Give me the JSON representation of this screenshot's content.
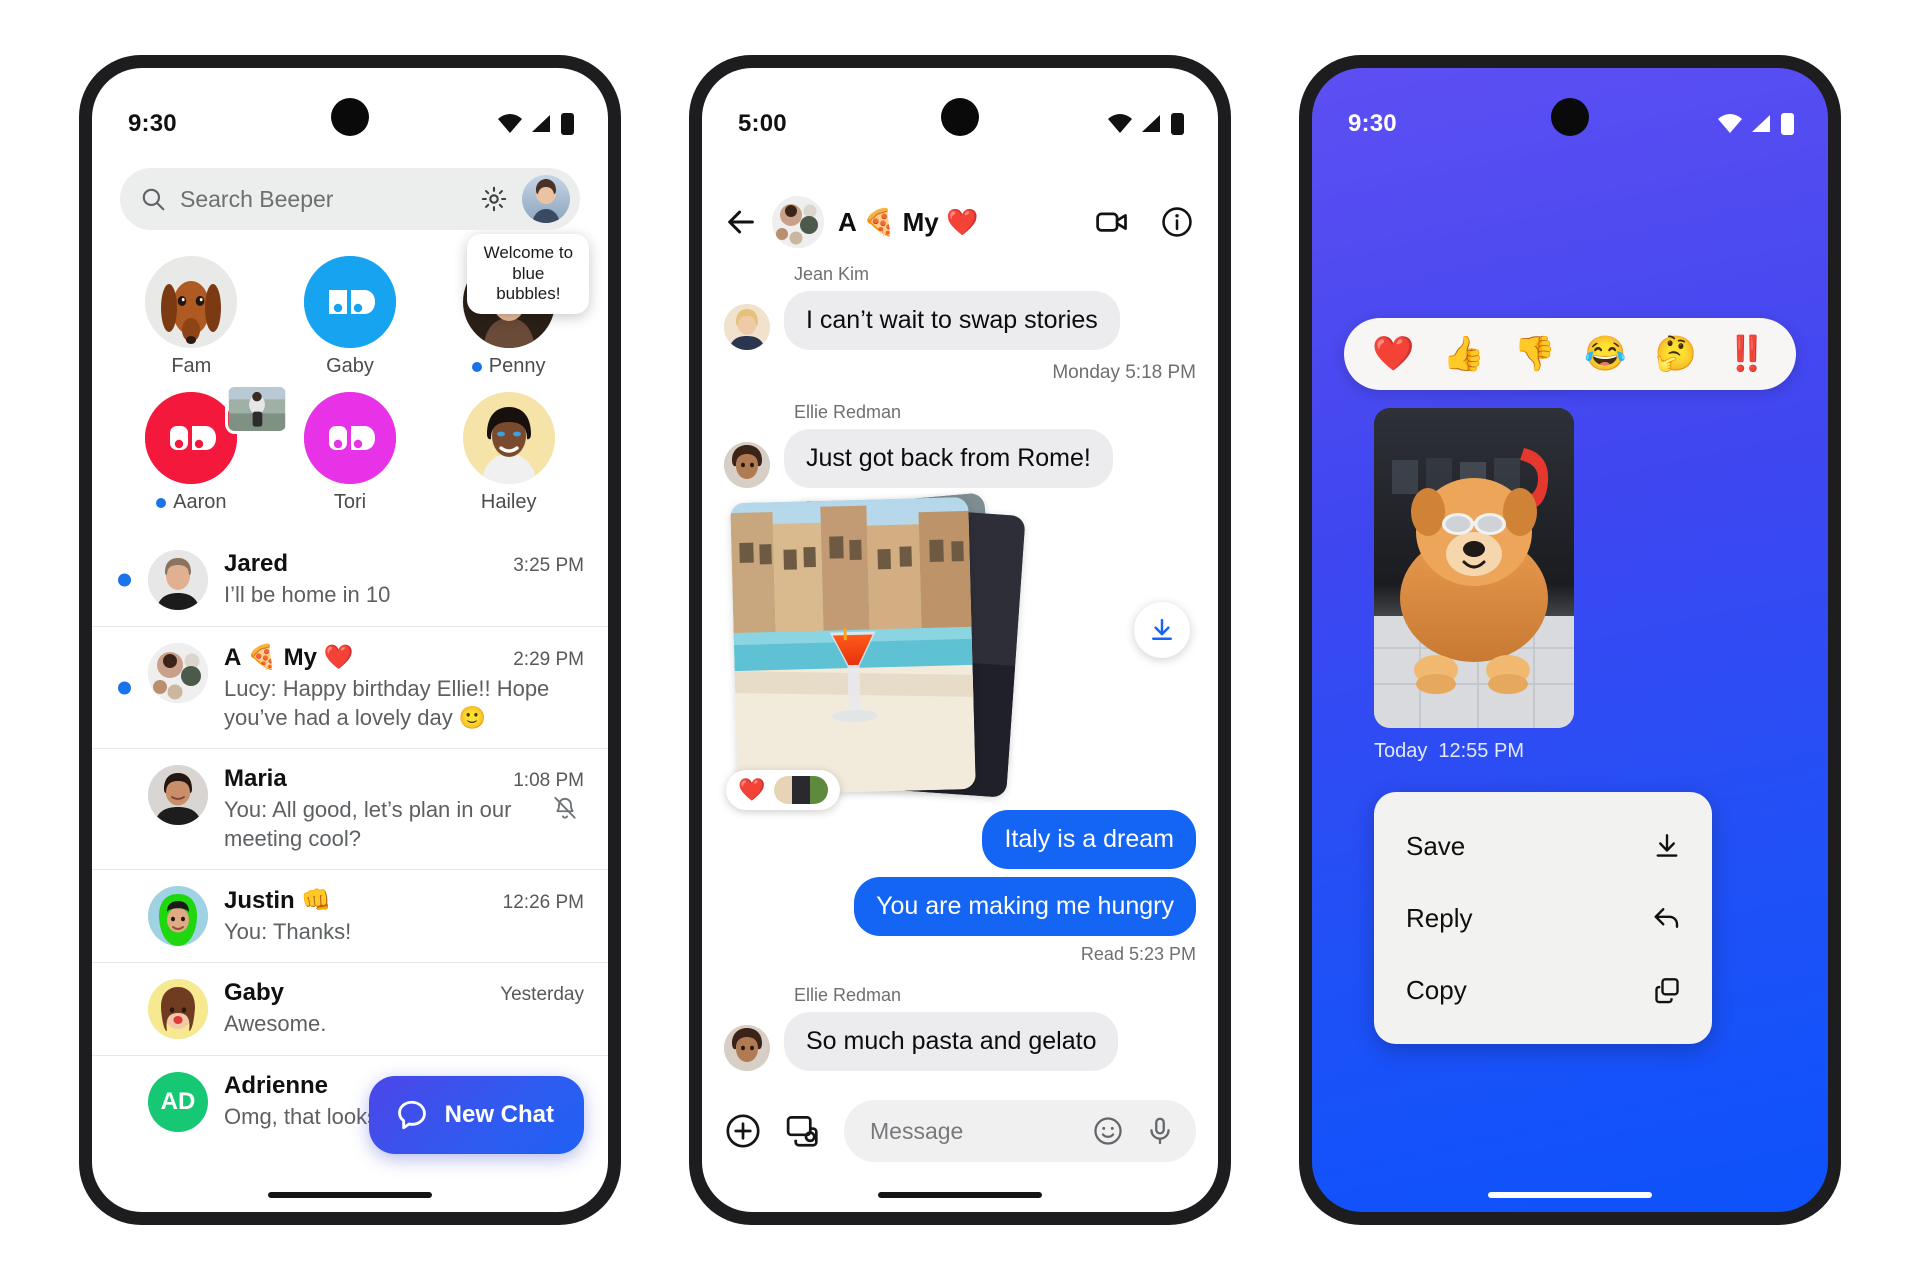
{
  "phone1": {
    "status": {
      "time": "9:30"
    },
    "search": {
      "placeholder": "Search Beeper",
      "icon": "search-icon",
      "settings_icon": "gear-icon"
    },
    "pinned": [
      {
        "name": "Fam",
        "unread": false,
        "avatar": "dog-photo"
      },
      {
        "name": "Gaby",
        "unread": false,
        "avatar": "beeper-logo-blue"
      },
      {
        "name": "Penny",
        "unread": true,
        "avatar": "woman-photo",
        "tooltip": "Welcome to blue bubbles!"
      },
      {
        "name": "Aaron",
        "unread": true,
        "avatar": "beeper-logo-red",
        "mini_thumb": true
      },
      {
        "name": "Tori",
        "unread": false,
        "avatar": "beeper-logo-magenta"
      },
      {
        "name": "Hailey",
        "unread": false,
        "avatar": "woman-photo-2"
      }
    ],
    "chats": [
      {
        "name": "Jared",
        "time": "3:25 PM",
        "preview": "I’ll be home in 10",
        "unread": true,
        "muted": false,
        "avatar": "man-black-shirt"
      },
      {
        "name": "A 🍕 My ❤️",
        "time": "2:29 PM",
        "preview": "Lucy: Happy birthday Ellie!! Hope you’ve had a lovely day  🙂",
        "unread": true,
        "muted": false,
        "avatar": "group-cluster"
      },
      {
        "name": "Maria",
        "time": "1:08 PM",
        "preview": "You: All good, let’s plan in our meeting cool?",
        "unread": false,
        "muted": true,
        "avatar": "woman-smiling"
      },
      {
        "name": "Justin 👊",
        "time": "12:26 PM",
        "preview": "You: Thanks!",
        "unread": false,
        "muted": false,
        "avatar": "man-green-hood"
      },
      {
        "name": "Gaby",
        "time": "Yesterday",
        "preview": "Awesome.",
        "unread": false,
        "muted": false,
        "avatar": "memoji-yellow"
      },
      {
        "name": "Adrienne",
        "time": "",
        "preview": "Omg, that looks so nice!",
        "unread": false,
        "muted": false,
        "avatar": "initials-green",
        "initials": "AD"
      }
    ],
    "fab": {
      "label": "New Chat",
      "icon": "chat-bubble-icon"
    }
  },
  "phone2": {
    "status": {
      "time": "5:00"
    },
    "header": {
      "back_icon": "back-arrow-icon",
      "title": "A 🍕 My ❤️",
      "video_icon": "video-camera-icon",
      "info_icon": "info-circle-icon"
    },
    "messages": [
      {
        "type": "incoming",
        "sender": "Jean Kim",
        "text": "I can’t wait to swap stories",
        "avatar": "woman-blonde"
      },
      {
        "type": "timestamp",
        "text": "Monday 5:18 PM"
      },
      {
        "type": "incoming",
        "sender": "Ellie Redman",
        "text": "Just got back from Rome!",
        "avatar": "woman-curly"
      },
      {
        "type": "photo_stack",
        "reaction": "❤️",
        "download_icon": "download-icon"
      },
      {
        "type": "outgoing",
        "text": "Italy is a dream"
      },
      {
        "type": "outgoing",
        "text": "You are making me hungry"
      },
      {
        "type": "read_receipt",
        "text": "Read  5:23 PM"
      },
      {
        "type": "incoming",
        "sender": "Ellie Redman",
        "text": "So much pasta and gelato",
        "avatar": "woman-curly"
      }
    ],
    "composer": {
      "plus_icon": "plus-circle-icon",
      "gallery_icon": "photo-camera-icon",
      "placeholder": "Message",
      "emoji_icon": "emoji-smiley-icon",
      "mic_icon": "microphone-icon"
    }
  },
  "phone3": {
    "status": {
      "time": "9:30"
    },
    "reactions": [
      "❤️",
      "👍",
      "👎",
      "😂",
      "🤔",
      "‼️"
    ],
    "media": {
      "caption_day": "Today",
      "caption_time": "12:55 PM",
      "alt": "dog-with-sunglasses-photo"
    },
    "context_menu": [
      {
        "label": "Save",
        "icon": "download-icon"
      },
      {
        "label": "Reply",
        "icon": "reply-arrow-icon"
      },
      {
        "label": "Copy",
        "icon": "copy-icon"
      }
    ]
  },
  "colors": {
    "accent_blue": "#1565f5",
    "unread_dot": "#1a73e8",
    "fab_gradient_start": "#4c46e8",
    "fab_gradient_end": "#1f61f5",
    "bubble_in": "#ececee",
    "phone3_bg_start": "#5d4ff2",
    "phone3_bg_end": "#0d52fb"
  }
}
